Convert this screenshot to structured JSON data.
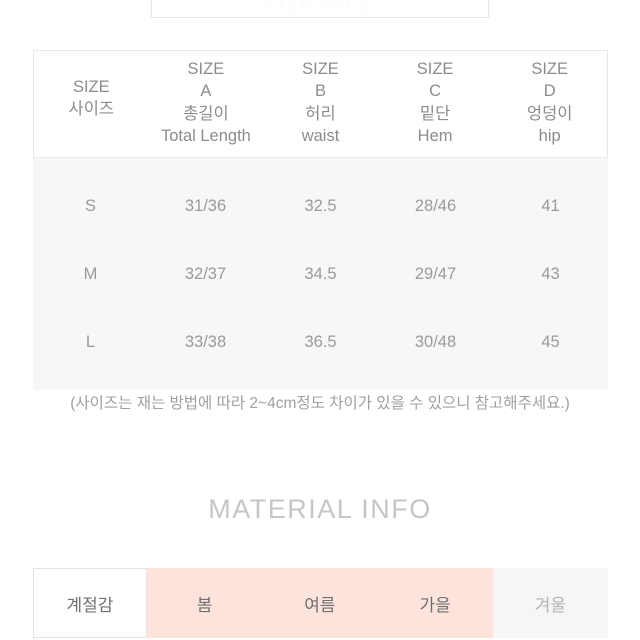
{
  "top_clipped_panel": {
    "ghost_text": "SIZE INFO"
  },
  "size_table": {
    "columns": [
      {
        "code": "SIZE",
        "letter": "",
        "kr": "사이즈",
        "en": ""
      },
      {
        "code": "SIZE",
        "letter": "A",
        "kr": "총길이",
        "en": "Total Length"
      },
      {
        "code": "SIZE",
        "letter": "B",
        "kr": "허리",
        "en": "waist"
      },
      {
        "code": "SIZE",
        "letter": "C",
        "kr": "밑단",
        "en": "Hem"
      },
      {
        "code": "SIZE",
        "letter": "D",
        "kr": "엉덩이",
        "en": "hip"
      }
    ],
    "rows": [
      {
        "size": "S",
        "a": "31/36",
        "b": "32.5",
        "c": "28/46",
        "d": "41"
      },
      {
        "size": "M",
        "a": "32/37",
        "b": "34.5",
        "c": "29/47",
        "d": "43"
      },
      {
        "size": "L",
        "a": "33/38",
        "b": "36.5",
        "c": "30/48",
        "d": "45"
      }
    ],
    "note": "(사이즈는 재는 방법에 따라 2~4cm정도 차이가 있을 수 있으니 참고해주세요.)"
  },
  "material_info": {
    "heading": "MATERIAL INFO",
    "season": {
      "label": "계절감",
      "options": [
        {
          "label": "봄",
          "selected": true
        },
        {
          "label": "여름",
          "selected": true
        },
        {
          "label": "가을",
          "selected": true
        },
        {
          "label": "겨울",
          "selected": false
        }
      ]
    }
  },
  "colors": {
    "selected_pink": "#fce3dc",
    "table_body_bg": "#f7f7f7",
    "unselected_grey": "#f6f6f6",
    "text_grey": "#8c8c8c",
    "heading_grey": "#c6c6c6"
  }
}
